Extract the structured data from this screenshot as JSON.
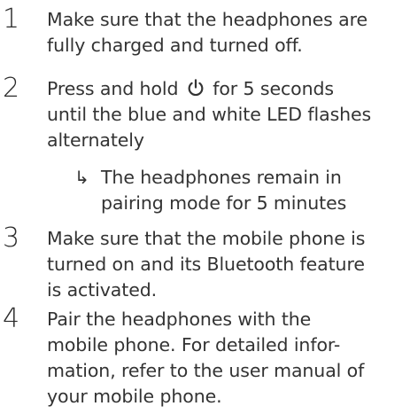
{
  "steps": [
    {
      "number": "1",
      "lines": [
        "Make sure that the headphones are",
        "fully charged and turned off."
      ]
    },
    {
      "number": "2",
      "line1_before": "Press and hold",
      "line1_after": "for 5 seconds",
      "icon": "power-icon",
      "lines_rest": [
        "until the blue and white LED flashes",
        "alternately"
      ],
      "sub": {
        "arrow": "↳",
        "lines": [
          "The headphones remain in",
          "pairing mode for 5 minutes"
        ]
      }
    },
    {
      "number": "3",
      "lines": [
        "Make sure that the mobile phone is",
        "turned on and its Bluetooth feature",
        "is activated."
      ]
    },
    {
      "number": "4",
      "lines": [
        "Pair the headphones with the",
        "mobile phone. For detailed infor-",
        "mation, refer to the user manual of",
        "your mobile phone."
      ]
    }
  ]
}
